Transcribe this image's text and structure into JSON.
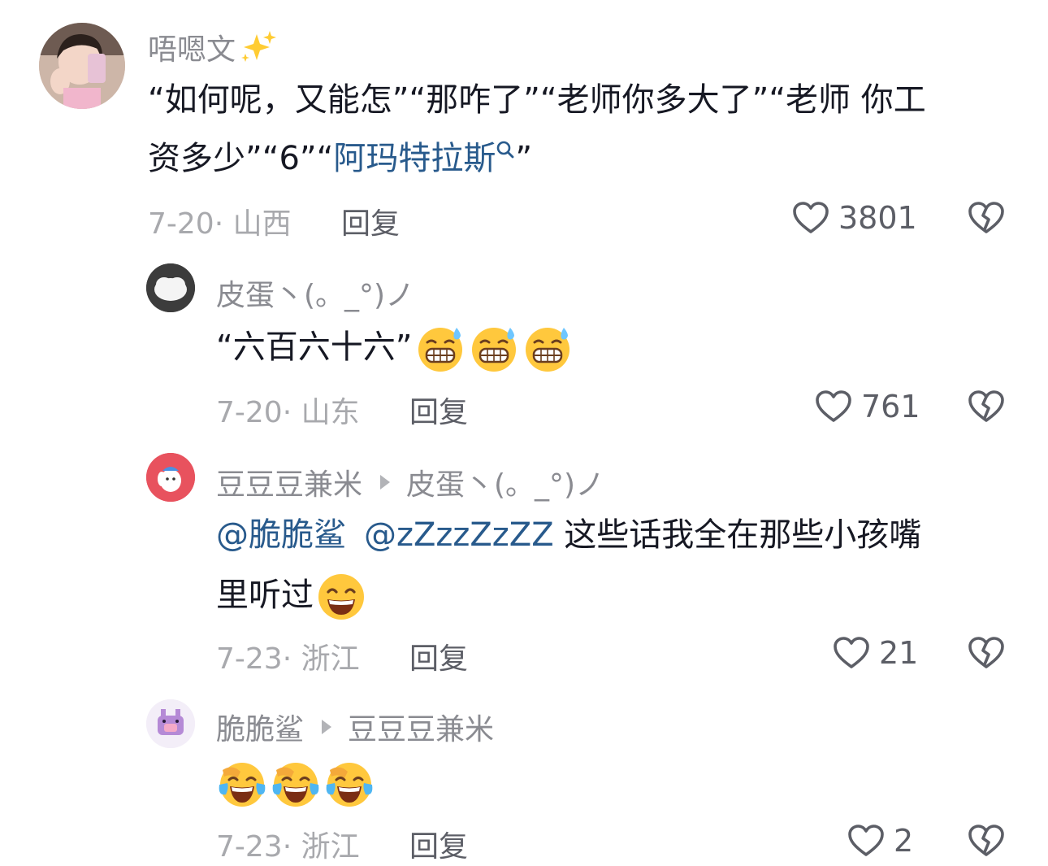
{
  "comments": [
    {
      "author": "唔嗯文",
      "author_suffix_icon": "sparkles-icon",
      "text_parts": {
        "plain": "“如何呢，又能怎”“那咋了”“老师你多大了”“老师 你工",
        "line2_plain": "资多少”“6”“",
        "search_link": "阿玛特拉斯",
        "tail": "”"
      },
      "date_location": "7-20· 山西",
      "reply_label": "回复",
      "likes": "3801"
    },
    {
      "author": "皮蛋丶(。_°)ノ",
      "text": "“六百六十六”",
      "emojis": [
        "sweat-grin-emoji",
        "sweat-grin-emoji",
        "sweat-grin-emoji"
      ],
      "date_location": "7-20· 山东",
      "reply_label": "回复",
      "likes": "761"
    },
    {
      "author": "豆豆豆兼米",
      "reply_to": "皮蛋丶(。_°)ノ",
      "mention1": "@脆脆鲨",
      "mention2": "@zZzzZzZZ",
      "text_line1": " 这些话我全在那些小孩嘴",
      "text_line2": "里听过",
      "emojis": [
        "grin-emoji"
      ],
      "date_location": "7-23· 浙江",
      "reply_label": "回复",
      "likes": "21"
    },
    {
      "author": "脆脆鲨",
      "reply_to": "豆豆豆兼米",
      "emojis": [
        "crying-laughing-emoji",
        "crying-laughing-emoji",
        "crying-laughing-emoji"
      ],
      "date_location": "7-23· 浙江",
      "reply_label": "回复",
      "likes": "2"
    }
  ],
  "colors": {
    "text": "#161823",
    "secondary": "#8a8b91",
    "link": "#285a8c",
    "emoji_yellow": "#ffc83d"
  }
}
